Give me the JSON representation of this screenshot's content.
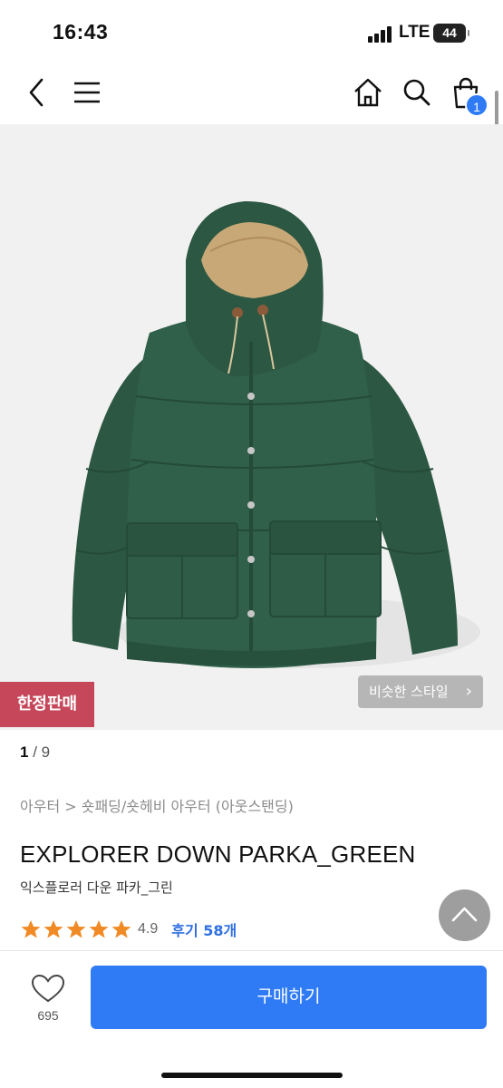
{
  "status_bar": {
    "time": "16:43",
    "network": "LTE",
    "battery": "44"
  },
  "nav": {
    "back_icon": "chevron-left-icon",
    "menu_icon": "hamburger-menu-icon",
    "home_icon": "home-icon",
    "search_icon": "search-icon",
    "cart_icon": "shopping-bag-icon",
    "cart_count": "1"
  },
  "hero": {
    "image": "green down parka product photo",
    "jacket_color": "#2f5a45",
    "limited_badge": "한정판매",
    "similar_style_label": "비슷한 스타일",
    "similar_style_icon": "chevron-right-icon"
  },
  "pager": {
    "current": "1",
    "separator": " / ",
    "total": "9"
  },
  "product": {
    "breadcrumb": "아우터 > 숏패딩/숏헤비 아우터 (아웃스탠딩)",
    "title": "EXPLORER DOWN PARKA_GREEN",
    "subtitle": "익스플로러 다운 파카_그린",
    "rating_stars": 5,
    "rating_value": "4.9",
    "review_label": "후기 58개"
  },
  "scroll_top_icon": "chevron-up-icon",
  "bottom_bar": {
    "like_icon": "heart-outline-icon",
    "like_count": "695",
    "buy_label": "구매하기"
  },
  "colors": {
    "accent": "#2f7bf5",
    "badge": "#c6475a",
    "star": "#f08a24",
    "review_link": "#2f6fe0"
  }
}
